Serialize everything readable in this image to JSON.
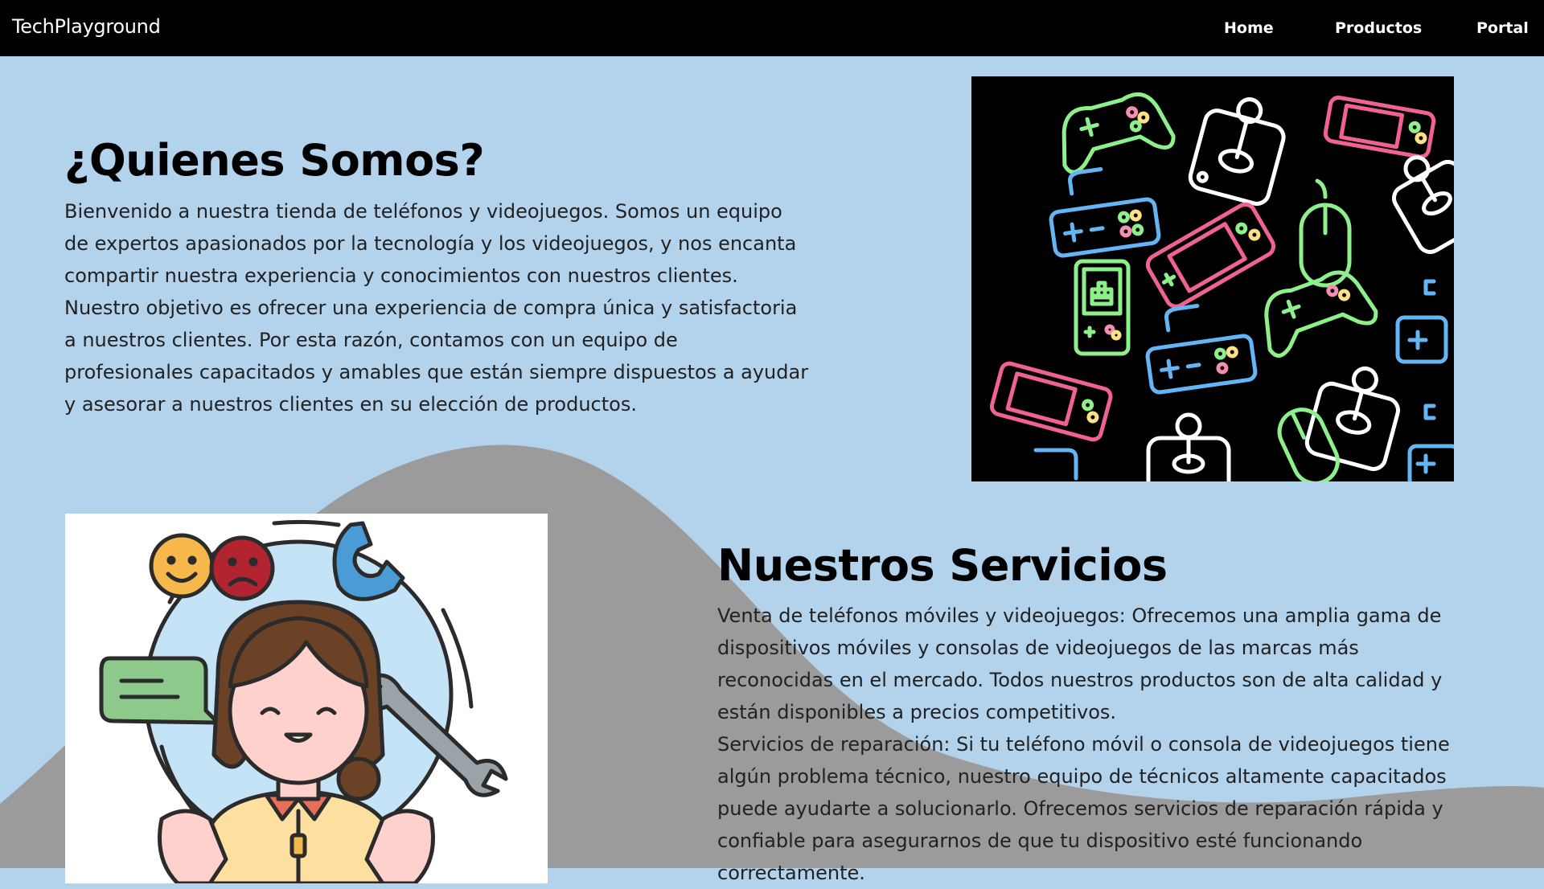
{
  "navbar": {
    "brand": "TechPlayground",
    "links": [
      "Home",
      "Productos",
      "Portal"
    ]
  },
  "about": {
    "title": "¿Quienes Somos?",
    "text": "Bienvenido a nuestra tienda de teléfonos y videojuegos. Somos un equipo de expertos apasionados por la tecnología y los videojuegos, y nos encanta compartir nuestra experiencia y conocimientos con nuestros clientes. Nuestro objetivo es ofrecer una experiencia de compra única y satisfactoria a nuestros clientes. Por esta razón, contamos con un equipo de profesionales capacitados y amables que están siempre dispuestos a ayudar y asesorar a nuestros clientes en su elección de productos.",
    "image": "neon-game-controllers-illustration"
  },
  "services": {
    "title": "Nuestros Servicios",
    "paragraphs": [
      "Venta de teléfonos móviles y videojuegos: Ofrecemos una amplia gama de dispositivos móviles y consolas de videojuegos de las marcas más reconocidas en el mercado. Todos nuestros productos son de alta calidad y están disponibles a precios competitivos.",
      "Servicios de reparación: Si tu teléfono móvil o consola de videojuegos tiene algún problema técnico, nuestro equipo de técnicos altamente capacitados puede ayudarte a solucionarlo. Ofrecemos servicios de reparación rápida y confiable para asegurarnos de que tu dispositivo esté funcionando correctamente."
    ],
    "image": "customer-support-illustration"
  },
  "colors": {
    "background": "#b3d2ec",
    "wave": "#9b9b9b",
    "navbar": "#000000"
  }
}
